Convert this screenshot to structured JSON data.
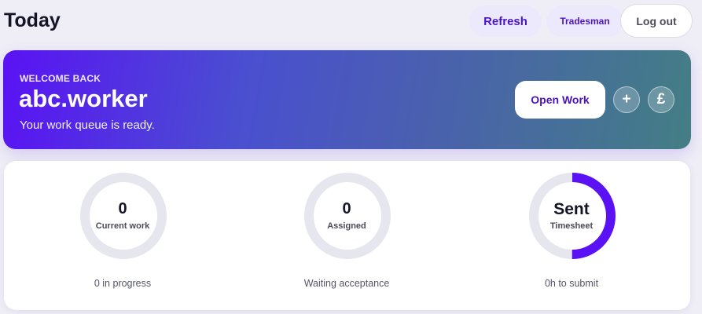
{
  "header": {
    "title": "Today",
    "refresh_label": "Refresh",
    "role_label": "Tradesman",
    "logout_label": "Log out"
  },
  "hero": {
    "kicker": "WELCOME BACK",
    "username": "abc.worker",
    "subtitle": "Your work queue is ready.",
    "open_work_label": "Open Work",
    "plus_icon": "+",
    "pound_icon": "£",
    "gradient_colors": [
      "#5a12f4",
      "#437e84"
    ]
  },
  "stats": [
    {
      "value": "0",
      "label": "Current work",
      "caption": "0 in progress",
      "progress": 0
    },
    {
      "value": "0",
      "label": "Assigned",
      "caption": "Waiting acceptance",
      "progress": 0
    },
    {
      "value": "Sent",
      "label": "Timesheet",
      "caption": "0h to submit",
      "progress": 0.5
    }
  ],
  "colors": {
    "accent": "#5a12f4",
    "ring_track": "#e6e6ee",
    "button_text": "#4a14c8"
  }
}
